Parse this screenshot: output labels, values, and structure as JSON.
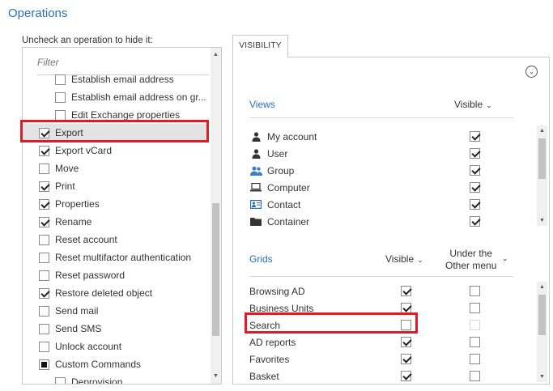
{
  "page": {
    "title": "Operations",
    "hint": "Uncheck an operation to hide it:"
  },
  "filter": {
    "placeholder": "Filter"
  },
  "operations": [
    {
      "label": "Establish email address",
      "checked": false,
      "indent": true
    },
    {
      "label": "Establish email address on gr...",
      "checked": false,
      "indent": true
    },
    {
      "label": "Edit Exchange properties",
      "checked": false,
      "indent": true
    },
    {
      "label": "Export",
      "checked": true,
      "indent": false,
      "selected": true
    },
    {
      "label": "Export vCard",
      "checked": true,
      "indent": false
    },
    {
      "label": "Move",
      "checked": false,
      "indent": false
    },
    {
      "label": "Print",
      "checked": true,
      "indent": false
    },
    {
      "label": "Properties",
      "checked": true,
      "indent": false
    },
    {
      "label": "Rename",
      "checked": true,
      "indent": false
    },
    {
      "label": "Reset account",
      "checked": false,
      "indent": false
    },
    {
      "label": "Reset multifactor authentication",
      "checked": false,
      "indent": false
    },
    {
      "label": "Reset password",
      "checked": false,
      "indent": false
    },
    {
      "label": "Restore deleted object",
      "checked": true,
      "indent": false
    },
    {
      "label": "Send mail",
      "checked": false,
      "indent": false
    },
    {
      "label": "Send SMS",
      "checked": false,
      "indent": false
    },
    {
      "label": "Unlock account",
      "checked": false,
      "indent": false
    },
    {
      "label": "Custom Commands",
      "checked": "partial",
      "indent": false
    },
    {
      "label": "Deprovision",
      "checked": false,
      "indent": true
    }
  ],
  "visibility_tab": {
    "label": "VISIBILITY"
  },
  "views": {
    "title": "Views",
    "visible_header": "Visible",
    "rows": [
      {
        "label": "My account",
        "icon": "user-icon",
        "visible": true
      },
      {
        "label": "User",
        "icon": "user-icon",
        "visible": true
      },
      {
        "label": "Group",
        "icon": "group-icon",
        "visible": true
      },
      {
        "label": "Computer",
        "icon": "computer-icon",
        "visible": true
      },
      {
        "label": "Contact",
        "icon": "contact-card-icon",
        "visible": true
      },
      {
        "label": "Container",
        "icon": "folder-icon",
        "visible": true
      }
    ]
  },
  "grids": {
    "title": "Grids",
    "visible_header": "Visible",
    "other_menu_header_line1": "Under the",
    "other_menu_header_line2": "Other menu",
    "rows": [
      {
        "label": "Browsing AD",
        "visible": true,
        "other_menu": false,
        "other_disabled": false
      },
      {
        "label": "Business Units",
        "visible": true,
        "other_menu": false,
        "other_disabled": false
      },
      {
        "label": "Search",
        "visible": false,
        "other_menu": false,
        "other_disabled": true
      },
      {
        "label": "AD reports",
        "visible": true,
        "other_menu": false,
        "other_disabled": false
      },
      {
        "label": "Favorites",
        "visible": true,
        "other_menu": false,
        "other_disabled": false
      },
      {
        "label": "Basket",
        "visible": true,
        "other_menu": false,
        "other_disabled": false
      }
    ]
  },
  "colors": {
    "accent": "#2b6fb7",
    "highlight": "#e21b24",
    "selected_row": "#e3e3e3"
  }
}
